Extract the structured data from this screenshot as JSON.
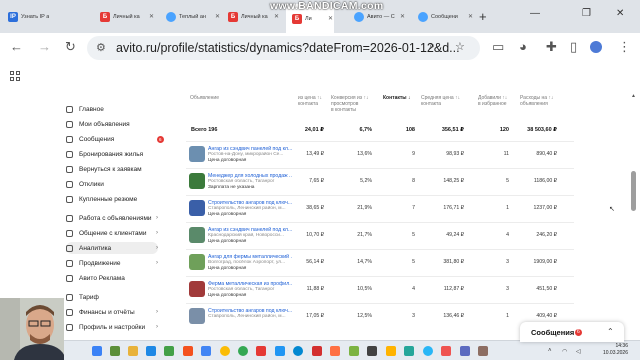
{
  "tabs": [
    {
      "label": "Узнать IP а",
      "fav_text": "IP",
      "fav_color": "#2c6fdb"
    },
    {
      "label": "Личный ка",
      "fav_text": "Б",
      "fav_color": "#e53935"
    },
    {
      "label": "Теплый ан",
      "fav_text": "",
      "fav_color": "#4aa3ff"
    },
    {
      "label": "Личный ка",
      "fav_text": "Б",
      "fav_color": "#e53935"
    },
    {
      "label": "Ли",
      "fav_text": "Б",
      "fav_color": "#e53935",
      "active": true
    },
    {
      "label": "Авито — С",
      "fav_text": "",
      "fav_color": "#4aa3ff"
    },
    {
      "label": "Сообщени",
      "fav_text": "",
      "fav_color": "#4aa3ff"
    }
  ],
  "overlay": {
    "bandicam": "www.BANDICAM.com"
  },
  "address": {
    "url": "avito.ru/profile/statistics/dynamics?dateFrom=2026-01-12&d..."
  },
  "sidebar": [
    {
      "label": "Главное"
    },
    {
      "label": "Мои объявления"
    },
    {
      "label": "Сообщения",
      "badge": "6"
    },
    {
      "label": "Бронирования жилья"
    },
    {
      "label": "Вернуться к заявкам"
    },
    {
      "label": "Отклики"
    },
    {
      "label": "Купленные резюме"
    },
    {
      "label": "Работа с объявлениями",
      "chevron": true
    },
    {
      "label": "Общение с клиентами",
      "chevron": true
    },
    {
      "label": "Аналитика",
      "chevron": true,
      "active": true
    },
    {
      "label": "Продвижение",
      "chevron": true
    },
    {
      "label": "Авито Реклама"
    },
    {
      "label": "Тариф"
    },
    {
      "label": "Финансы и отчёты",
      "chevron": true
    },
    {
      "label": "Профиль и настройки",
      "chevron": true
    }
  ],
  "table": {
    "headers": [
      "Объявление",
      "из цена ↑↓\nконтакта",
      "Конверсия из ↑↓\nпросмотров\nв контакты",
      "Контакты ↓",
      "Средняя цена ↑↓\nконтакта",
      "Добавили ↑↓\nв избранное",
      "Расходы на ↑↓\nобъявления"
    ],
    "total": {
      "label": "Всего 196",
      "c1": "24,01 ₽",
      "c2": "6,7%",
      "c3": "108",
      "c4": "356,51 ₽",
      "c5": "120",
      "c6": "38 503,60 ₽"
    },
    "rows": [
      {
        "t1": "Ангар из сэндвич панелей под кл...",
        "t2": "Ростов-на-Дону, микрорайон Се...",
        "t3": "Цена договорная",
        "c1": "13,49 ₽",
        "c2": "13,6%",
        "c3": "9",
        "c4": "98,93 ₽",
        "c5": "11",
        "c6": "890,40 ₽",
        "thumb": "#6c8fb0"
      },
      {
        "t1": "Менеджер для холодных продаж ...",
        "t2": "Ростовская область, Таганрог",
        "t3": "Зарплата не указана",
        "c1": "7,65 ₽",
        "c2": "5,2%",
        "c3": "8",
        "c4": "148,25 ₽",
        "c5": "5",
        "c6": "1186,00 ₽",
        "thumb": "#3b7a3b"
      },
      {
        "t1": "Строительство ангаров под ключ...",
        "t2": "Ставрополь, Ленинский район, м...",
        "t3": "Цена договорная",
        "c1": "38,65 ₽",
        "c2": "21,9%",
        "c3": "7",
        "c4": "176,71 ₽",
        "c5": "1",
        "c6": "1237,00 ₽",
        "thumb": "#3a5fa8"
      },
      {
        "t1": "Ангар из сэндвич панелей под кл...",
        "t2": "Краснодарский край, Новоросси...",
        "t3": "Цена договорная",
        "c1": "10,70 ₽",
        "c2": "21,7%",
        "c3": "5",
        "c4": "49,24 ₽",
        "c5": "4",
        "c6": "246,20 ₽",
        "thumb": "#5a8a6a"
      },
      {
        "t1": "Ангар для фермы металлический ...",
        "t2": "Волгоград, посёлок Аэропорт, ул...",
        "t3": "Цена договорная",
        "c1": "56,14 ₽",
        "c2": "14,7%",
        "c3": "5",
        "c4": "381,80 ₽",
        "c5": "3",
        "c6": "1909,00 ₽",
        "thumb": "#6fa05a"
      },
      {
        "t1": "Ферма металлическая из профил...",
        "t2": "Ростовская область, Таганрог",
        "t3": "Цена договорная",
        "c1": "11,88 ₽",
        "c2": "10,5%",
        "c3": "4",
        "c4": "112,87 ₽",
        "c5": "3",
        "c6": "451,50 ₽",
        "thumb": "#a13a3a"
      },
      {
        "t1": "Строительство ангаров под ключ...",
        "t2": "Ставрополь, Ленинский район, м...",
        "t3": "",
        "c1": "17,05 ₽",
        "c2": "12,5%",
        "c3": "3",
        "c4": "136,46 ₽",
        "c5": "1",
        "c6": "409,40 ₽",
        "thumb": "#7a8fa8"
      }
    ]
  },
  "messages_popup": {
    "title": "Сообщения",
    "badge": "6"
  },
  "clock": {
    "time": "14:36",
    "date": "10.03.2026"
  }
}
